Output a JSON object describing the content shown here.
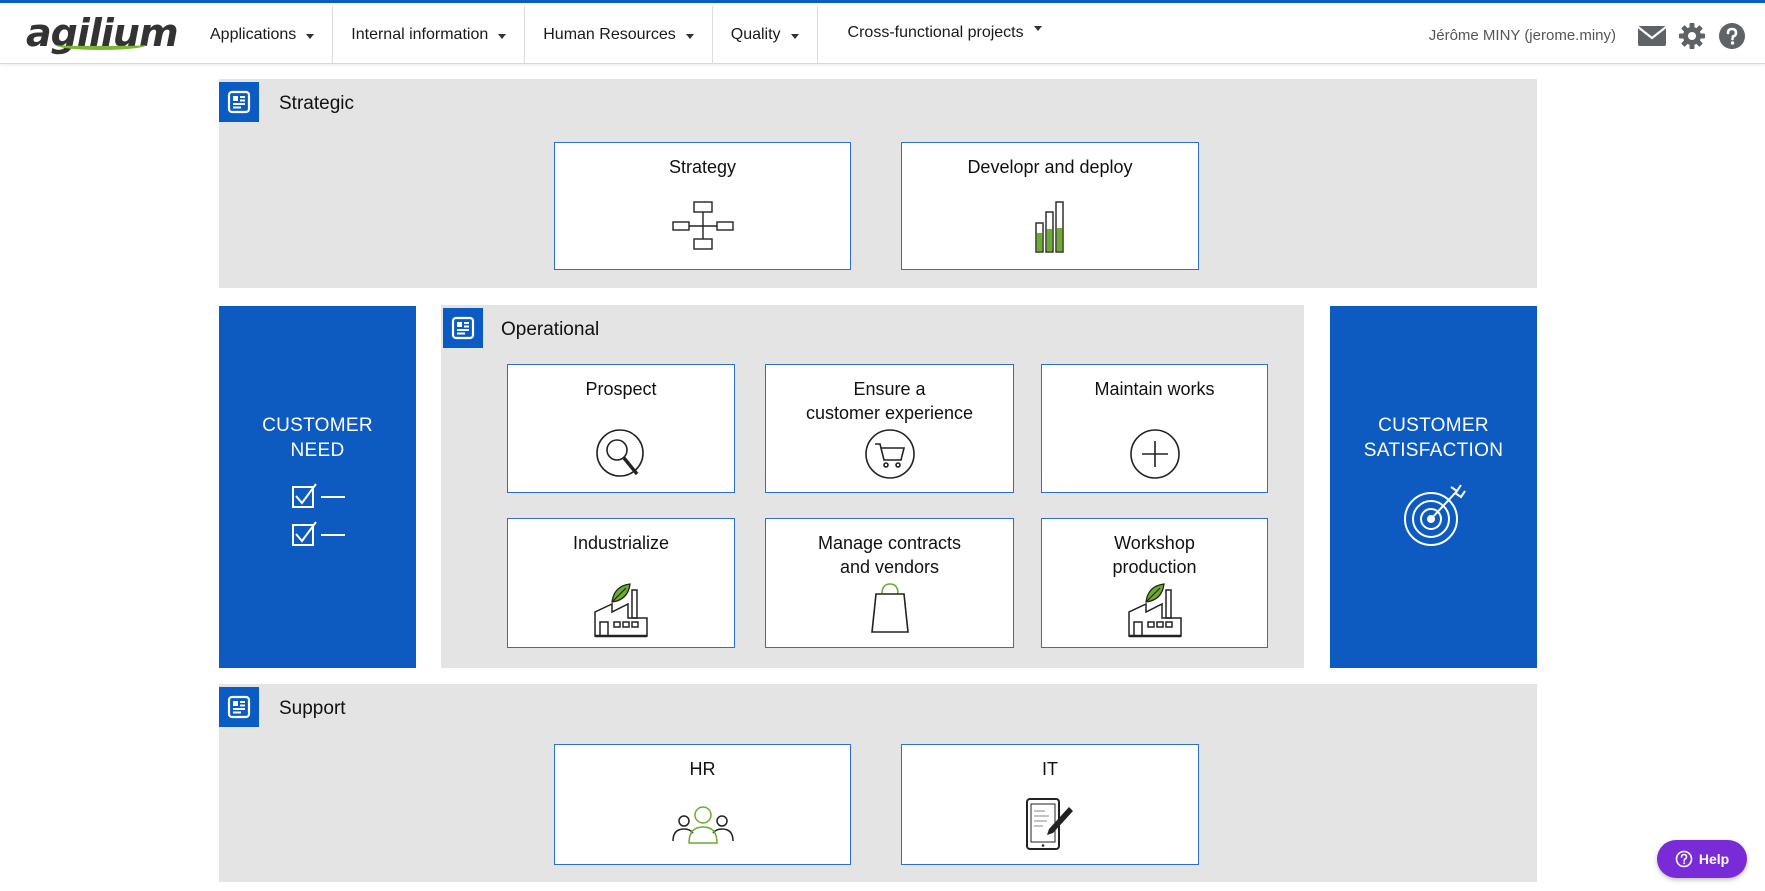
{
  "app": {
    "logo": "agilium",
    "user": "Jérôme MINY (jerome.miny)"
  },
  "nav": [
    {
      "label": "Applications"
    },
    {
      "label": "Internal information"
    },
    {
      "label": "Human Resources"
    },
    {
      "label": "Quality"
    },
    {
      "label": "Cross-functional projects"
    }
  ],
  "icons": {
    "mail": "mail-icon",
    "settings": "gear-icon",
    "help": "question-circle-icon"
  },
  "colors": {
    "brand_blue": "#0d5bc0",
    "accent_green": "#78b833",
    "help_purple": "#7a2bd8",
    "panel_grey": "#e4e4e4"
  },
  "strategic": {
    "title": "Strategic",
    "cards": [
      {
        "title": "Strategy",
        "icon": "org-chart-icon"
      },
      {
        "title": "Developr and deploy",
        "icon": "bar-chart-icon"
      }
    ]
  },
  "customer_need": {
    "line1": "CUSTOMER",
    "line2": "NEED",
    "icon": "checklist-icon"
  },
  "operational": {
    "title": "Operational",
    "cards": [
      {
        "title": "Prospect",
        "icon": "magnifier-icon"
      },
      {
        "line1": "Ensure a",
        "line2": "customer experience",
        "icon": "cart-icon"
      },
      {
        "title": "Maintain works",
        "icon": "plus-circle-icon"
      },
      {
        "title": "Industrialize",
        "icon": "factory-icon"
      },
      {
        "line1": "Manage contracts",
        "line2": "and vendors",
        "icon": "shopping-bag-icon"
      },
      {
        "line1": "Workshop",
        "line2": "production",
        "icon": "factory-icon"
      }
    ]
  },
  "customer_satisfaction": {
    "line1": "CUSTOMER",
    "line2": "SATISFACTION",
    "icon": "target-icon"
  },
  "support": {
    "title": "Support",
    "cards": [
      {
        "title": "HR",
        "icon": "people-icon"
      },
      {
        "title": "IT",
        "icon": "tablet-pen-icon"
      }
    ]
  },
  "help_button": {
    "label": "Help"
  }
}
